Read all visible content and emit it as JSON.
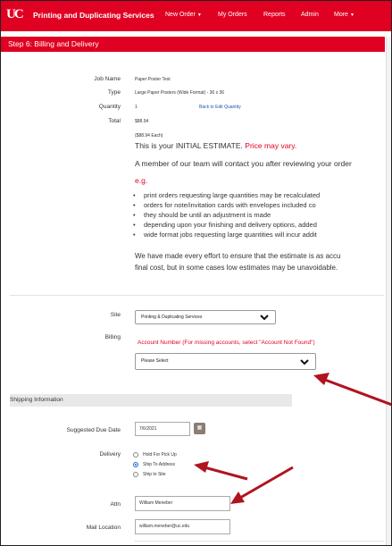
{
  "header": {
    "logo_text": "UC",
    "brand": "Printing and Duplicating Services",
    "nav": [
      {
        "label": "New Order",
        "has_caret": true
      },
      {
        "label": "My Orders",
        "has_caret": false
      },
      {
        "label": "Reports",
        "has_caret": false
      },
      {
        "label": "Admin",
        "has_caret": false
      },
      {
        "label": "More",
        "has_caret": true
      }
    ]
  },
  "step": {
    "title": "Step 6: Billing and Delivery"
  },
  "summary": {
    "job_name_label": "Job Name",
    "job_name_value": "Paper Poster Test",
    "type_label": "Type",
    "type_value": "Large Paper Posters (Wide Format) - 36 x 36",
    "quantity_label": "Quantity",
    "quantity_value": "1",
    "back_link": "Back to Edit Quantity",
    "total_label": "Total",
    "total_value": "$88.94",
    "each_value": "($88.94 Each)"
  },
  "estimate": {
    "initial_prefix": "This is your INITIAL ESTIMATE.",
    "initial_red": "Price may vary.",
    "member_text": "A member of our team will contact you after reviewing your order",
    "eg": "e.g.",
    "bullets": [
      "print orders requesting large quantities may be recalculated",
      "orders for note/invitation cards with envelopes included co",
      "they should be until an adjustment is made",
      "depending upon your finishing and delivery options, added",
      "wide format jobs requesting large quantities will incur addit"
    ],
    "effort_line1": "We have made every effort to ensure that the estimate is as accu",
    "effort_line2": "final cost, but in some cases low estimates may be unavoidable."
  },
  "billing": {
    "site_label": "Site",
    "site_value": "Printing & Duplicating Services",
    "billing_label": "Billing",
    "account_hint": "Account Number (For missing accounts, select \"Account Not Found\")",
    "account_placeholder": "Please Select"
  },
  "shipping": {
    "section_title": "Shipping Information",
    "due_label": "Suggested Due Date",
    "due_value": "7/6/2021",
    "delivery_label": "Delivery",
    "options": [
      {
        "label": "Hold For Pick Up",
        "selected": false
      },
      {
        "label": "Ship To Address",
        "selected": true
      },
      {
        "label": "Ship to Site",
        "selected": false
      }
    ],
    "attn_label": "Attn",
    "attn_value": "William Meneber",
    "mail_label": "Mail Location",
    "mail_value": "william.meneber@uc.edu"
  },
  "colors": {
    "brand_red": "#e00122",
    "annotation_arrow": "#b0141e",
    "link_blue": "#1a56b0"
  }
}
